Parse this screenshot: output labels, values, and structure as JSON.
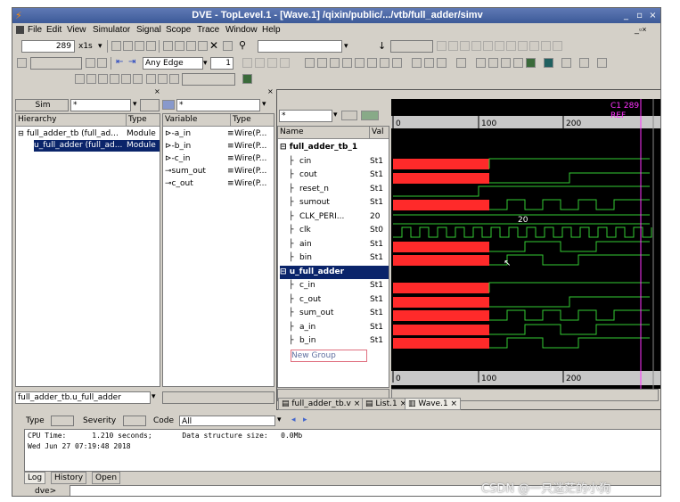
{
  "window": {
    "title": "DVE - TopLevel.1 - [Wave.1]  /qixin/public/.../vtb/full_adder/simv",
    "controls": [
      "_",
      "▫",
      "×"
    ]
  },
  "menu": [
    "File",
    "Edit",
    "View",
    "Simulator",
    "Signal",
    "Scope",
    "Trace",
    "Window",
    "Help"
  ],
  "toolbar": {
    "time_value": "289",
    "time_unit": "x1s",
    "edge_mode": "Any Edge",
    "step_count": "1"
  },
  "hierarchy": {
    "sim_label": "Sim",
    "filter": "*",
    "col_name": "Hierarchy",
    "col_type": "Type",
    "rows": [
      {
        "name": "full_adder_tb (full_ad...",
        "type": "Module"
      },
      {
        "name": "u_full_adder (full_ad...",
        "type": "Module"
      }
    ],
    "status_path": "full_adder_tb.u_full_adder"
  },
  "variables": {
    "filter": "*",
    "col_name": "Variable",
    "col_type": "Type",
    "rows": [
      {
        "name": "a_in",
        "type": "Wire(P..."
      },
      {
        "name": "b_in",
        "type": "Wire(P..."
      },
      {
        "name": "c_in",
        "type": "Wire(P..."
      },
      {
        "name": "sum_out",
        "type": "Wire(P..."
      },
      {
        "name": "c_out",
        "type": "Wire(P..."
      }
    ]
  },
  "wave": {
    "filter": "*",
    "col_name": "Name",
    "col_value": "Val",
    "cursor_label": "C1 289",
    "ref_label": "REF",
    "time_ticks": [
      "0",
      "100",
      "200"
    ],
    "clk_period_value": "20",
    "groups": [
      {
        "name": "full_adder_tb_1",
        "signals": [
          {
            "name": "cin",
            "value": "St1"
          },
          {
            "name": "cout",
            "value": "St1"
          },
          {
            "name": "reset_n",
            "value": "St1"
          },
          {
            "name": "sumout",
            "value": "St1"
          },
          {
            "name": "CLK_PERI...",
            "value": "20"
          },
          {
            "name": "clk",
            "value": "St0"
          },
          {
            "name": "ain",
            "value": "St1"
          },
          {
            "name": "bin",
            "value": "St1"
          }
        ]
      },
      {
        "name": "u_full_adder",
        "signals": [
          {
            "name": "c_in",
            "value": "St1"
          },
          {
            "name": "c_out",
            "value": "St1"
          },
          {
            "name": "sum_out",
            "value": "St1"
          },
          {
            "name": "a_in",
            "value": "St1"
          },
          {
            "name": "b_in",
            "value": "St1"
          }
        ]
      }
    ],
    "new_group": "New Group"
  },
  "doc_tabs": [
    "full_adder_tb.v",
    "List.1",
    "Wave.1"
  ],
  "console": {
    "type_label": "Type",
    "severity_label": "Severity",
    "code_label": "Code",
    "code_value": "All",
    "lines": [
      "CPU Time:      1.210 seconds;       Data structure size:   0.0Mb",
      "Wed Jun 27 07:19:48 2018"
    ],
    "tabs": [
      "Log",
      "History",
      "Open"
    ],
    "prompt": "dve>"
  },
  "watermark": "CSDN @一只迷茫的小狗",
  "colors": {
    "wave_bg": "#000000",
    "wave_green": "#33cc33",
    "wave_red": "#ff2a2a",
    "cursor": "#ff33ff",
    "select": "#0a246a"
  }
}
